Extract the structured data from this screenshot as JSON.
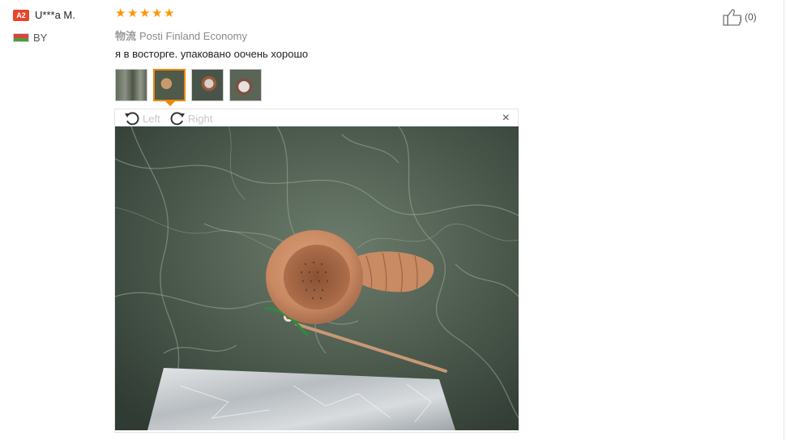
{
  "reviewer": {
    "level_badge": "A2",
    "name": "U***a M.",
    "country": "BY",
    "flag_colors": [
      "#d9453b",
      "#4a9a3d"
    ]
  },
  "review": {
    "rating": 5,
    "rating_stars": [
      "★",
      "★",
      "★",
      "★",
      "★"
    ],
    "star_color": "#ff9500",
    "logistics_label": "物流",
    "logistics_value": "Posti Finland Economy",
    "text": "я в восторге. упаковано оочень хорошо",
    "thumbnail_count": 4,
    "active_thumbnail": 2
  },
  "viewer": {
    "rotate_left_label": "Left",
    "rotate_right_label": "Right",
    "close_icon": "×"
  },
  "like": {
    "count_label": "(0)"
  },
  "colors": {
    "accent_orange": "#f0870c",
    "badge_red": "#e8452b"
  }
}
